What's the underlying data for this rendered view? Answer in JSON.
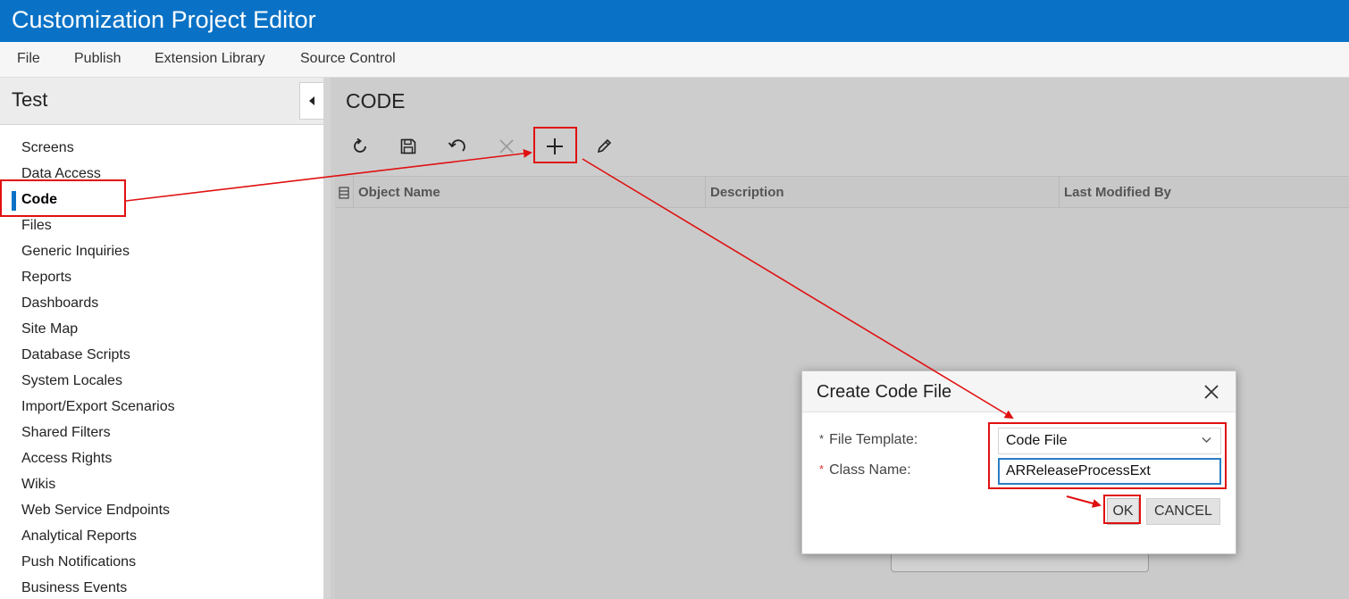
{
  "window": {
    "title": "Customization Project Editor"
  },
  "menu": [
    "File",
    "Publish",
    "Extension Library",
    "Source Control"
  ],
  "sidebar": {
    "project_name": "Test",
    "items": [
      {
        "label": "Screens"
      },
      {
        "label": "Data Access"
      },
      {
        "label": "Code",
        "active": true
      },
      {
        "label": "Files"
      },
      {
        "label": "Generic Inquiries"
      },
      {
        "label": "Reports"
      },
      {
        "label": "Dashboards"
      },
      {
        "label": "Site Map"
      },
      {
        "label": "Database Scripts"
      },
      {
        "label": "System Locales"
      },
      {
        "label": "Import/Export Scenarios"
      },
      {
        "label": "Shared Filters"
      },
      {
        "label": "Access Rights"
      },
      {
        "label": "Wikis"
      },
      {
        "label": "Web Service Endpoints"
      },
      {
        "label": "Analytical Reports"
      },
      {
        "label": "Push Notifications"
      },
      {
        "label": "Business Events"
      }
    ]
  },
  "main": {
    "heading": "CODE",
    "toolbar": [
      {
        "icon": "refresh-icon",
        "enabled": true
      },
      {
        "icon": "save-icon",
        "enabled": true
      },
      {
        "icon": "undo-icon",
        "enabled": true
      },
      {
        "icon": "delete-icon",
        "enabled": false
      },
      {
        "icon": "add-icon",
        "enabled": true
      },
      {
        "icon": "edit-icon",
        "enabled": true
      }
    ],
    "grid": {
      "columns": [
        "Object Name",
        "Description",
        "Last Modified By"
      ],
      "rows": []
    }
  },
  "dialog": {
    "title": "Create Code File",
    "fields": {
      "file_template": {
        "label": "File Template:",
        "value": "Code File"
      },
      "class_name": {
        "label": "Class Name:",
        "value": "ARReleaseProcessExt"
      }
    },
    "ok_label": "OK",
    "cancel_label": "CANCEL"
  },
  "annotations": {
    "color": "#e01010"
  },
  "colors": {
    "brand": "#0a72c6",
    "accent_active": "#0a72c6"
  }
}
